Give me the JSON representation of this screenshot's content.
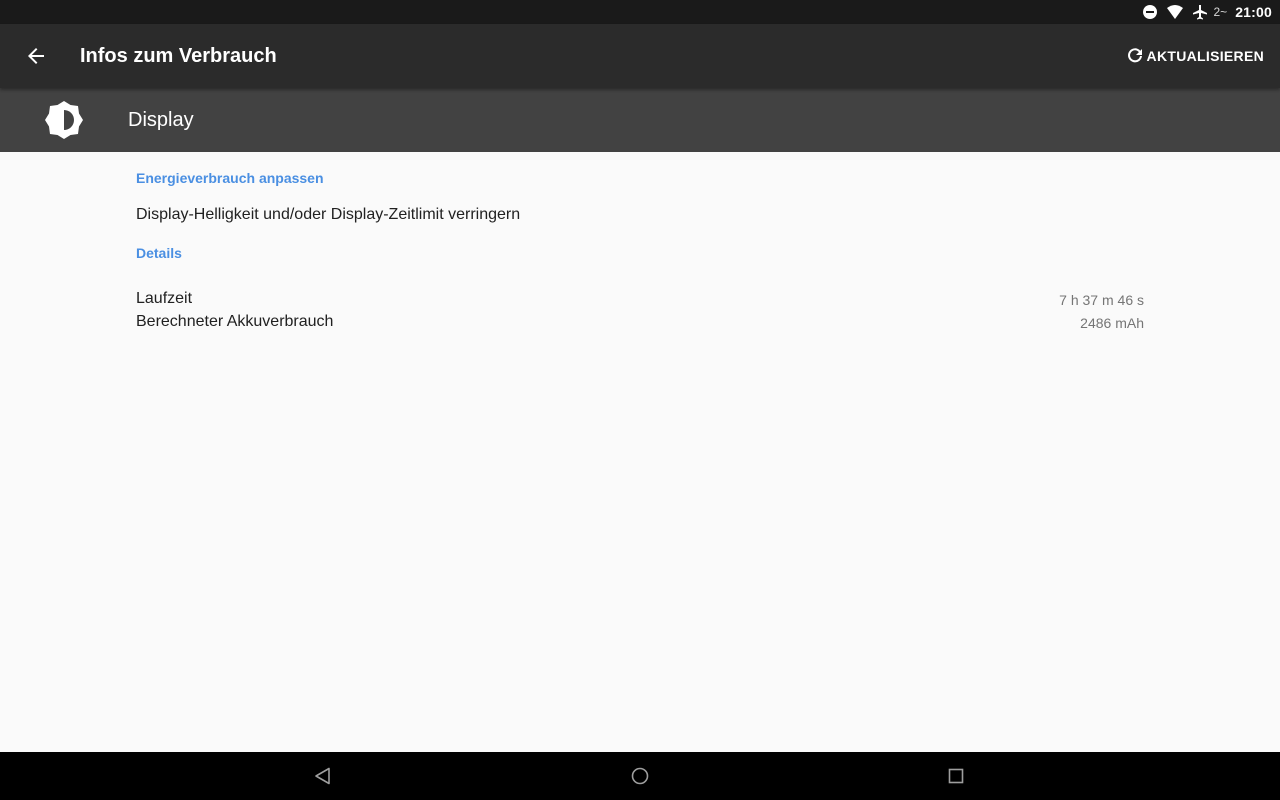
{
  "status_bar": {
    "icons": [
      "do-not-disturb-icon",
      "wifi-icon",
      "airplane-mode-icon"
    ],
    "sim_label": "2~",
    "time": "21:00"
  },
  "app_bar": {
    "title": "Infos zum Verbrauch",
    "refresh_label": "AKTUALISIEREN",
    "background": "#2b2b2b"
  },
  "header": {
    "icon": "brightness-icon",
    "title": "Display",
    "background": "#424242"
  },
  "sections": {
    "adjust_title": "Energieverbrauch anpassen",
    "adjust_tip": "Display-Helligkeit und/oder Display-Zeitlimit verringern",
    "details_title": "Details"
  },
  "details": [
    {
      "label": "Laufzeit",
      "value": "7 h 37 m 46 s"
    },
    {
      "label": "Berechneter Akkuverbrauch",
      "value": "2486 mAh"
    }
  ],
  "colors": {
    "accent": "#4a8fe2",
    "page_background": "#fafafa",
    "primary_text": "#212121",
    "secondary_text": "#757575"
  },
  "nav_bar": {
    "buttons": [
      "back-triangle-icon",
      "home-circle-icon",
      "recents-square-icon"
    ]
  }
}
